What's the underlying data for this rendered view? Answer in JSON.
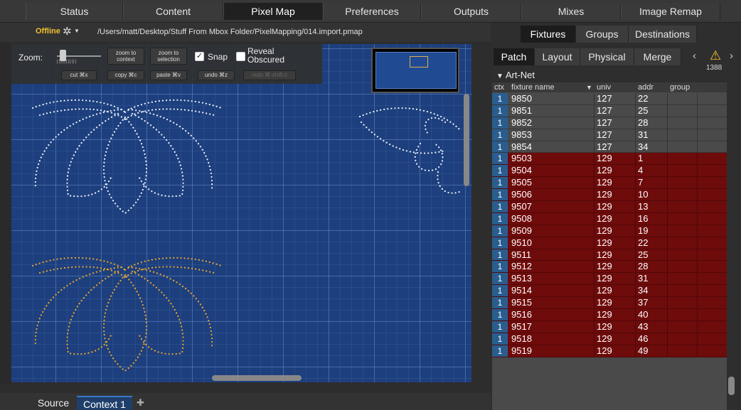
{
  "top_tabs": [
    {
      "label": "Status"
    },
    {
      "label": "Content"
    },
    {
      "label": "Pixel Map"
    },
    {
      "label": "Preferences"
    },
    {
      "label": "Outputs"
    },
    {
      "label": "Mixes"
    },
    {
      "label": "Image Remap"
    }
  ],
  "pathbar": {
    "status": "Offline",
    "path": "/Users/matt/Desktop/Stuff From Mbox Folder/PixelMapping/014.import.pmap"
  },
  "toolbar": {
    "zoom_label": "Zoom:",
    "zoom_to_context": "zoom to context",
    "zoom_to_selection": "zoom to selection",
    "snap_label": "Snap",
    "snap_checked": true,
    "reveal_label": "Reveal Obscured",
    "reveal_checked": false,
    "cut": "cut ⌘x",
    "copy": "copy ⌘c",
    "paste": "paste ⌘v",
    "undo": "undo ⌘z",
    "redo": "redo ⌘-shift-z"
  },
  "bottom_tabs": [
    {
      "label": "Source"
    },
    {
      "label": "Context 1"
    }
  ],
  "right_tabs": [
    {
      "label": "Fixtures"
    },
    {
      "label": "Groups"
    },
    {
      "label": "Destinations"
    }
  ],
  "sub_tabs": [
    {
      "label": "Patch"
    },
    {
      "label": "Layout"
    },
    {
      "label": "Physical"
    },
    {
      "label": "Merge"
    }
  ],
  "warning_count": "1388",
  "section_label": "Art-Net",
  "table": {
    "headers": {
      "ctx": "ctx",
      "name": "fixture name",
      "univ": "univ",
      "addr": "addr",
      "group": "group"
    },
    "rows": [
      {
        "ctx": "1",
        "name": "9850",
        "univ": "127",
        "addr": "22",
        "patched": false
      },
      {
        "ctx": "1",
        "name": "9851",
        "univ": "127",
        "addr": "25",
        "patched": false
      },
      {
        "ctx": "1",
        "name": "9852",
        "univ": "127",
        "addr": "28",
        "patched": false
      },
      {
        "ctx": "1",
        "name": "9853",
        "univ": "127",
        "addr": "31",
        "patched": false
      },
      {
        "ctx": "1",
        "name": "9854",
        "univ": "127",
        "addr": "34",
        "patched": false
      },
      {
        "ctx": "1",
        "name": "9503",
        "univ": "129",
        "addr": "1",
        "patched": true
      },
      {
        "ctx": "1",
        "name": "9504",
        "univ": "129",
        "addr": "4",
        "patched": true
      },
      {
        "ctx": "1",
        "name": "9505",
        "univ": "129",
        "addr": "7",
        "patched": true
      },
      {
        "ctx": "1",
        "name": "9506",
        "univ": "129",
        "addr": "10",
        "patched": true
      },
      {
        "ctx": "1",
        "name": "9507",
        "univ": "129",
        "addr": "13",
        "patched": true
      },
      {
        "ctx": "1",
        "name": "9508",
        "univ": "129",
        "addr": "16",
        "patched": true
      },
      {
        "ctx": "1",
        "name": "9509",
        "univ": "129",
        "addr": "19",
        "patched": true
      },
      {
        "ctx": "1",
        "name": "9510",
        "univ": "129",
        "addr": "22",
        "patched": true
      },
      {
        "ctx": "1",
        "name": "9511",
        "univ": "129",
        "addr": "25",
        "patched": true
      },
      {
        "ctx": "1",
        "name": "9512",
        "univ": "129",
        "addr": "28",
        "patched": true
      },
      {
        "ctx": "1",
        "name": "9513",
        "univ": "129",
        "addr": "31",
        "patched": true
      },
      {
        "ctx": "1",
        "name": "9514",
        "univ": "129",
        "addr": "34",
        "patched": true
      },
      {
        "ctx": "1",
        "name": "9515",
        "univ": "129",
        "addr": "37",
        "patched": true
      },
      {
        "ctx": "1",
        "name": "9516",
        "univ": "129",
        "addr": "40",
        "patched": true
      },
      {
        "ctx": "1",
        "name": "9517",
        "univ": "129",
        "addr": "43",
        "patched": true
      },
      {
        "ctx": "1",
        "name": "9518",
        "univ": "129",
        "addr": "46",
        "patched": true
      },
      {
        "ctx": "1",
        "name": "9519",
        "univ": "129",
        "addr": "49",
        "patched": true
      }
    ]
  },
  "colors": {
    "accent": "#f2c12e",
    "canvas": "#1d3f7d",
    "row_conflict": "#6e0b0b",
    "row_normal": "#4a4a4a",
    "fixture_white": "#e8eef8",
    "fixture_orange": "#e8a431"
  },
  "icons": {
    "gear": "gear-icon",
    "warning": "warning-icon",
    "expand": "triangle-down-icon",
    "add": "plus-icon"
  }
}
